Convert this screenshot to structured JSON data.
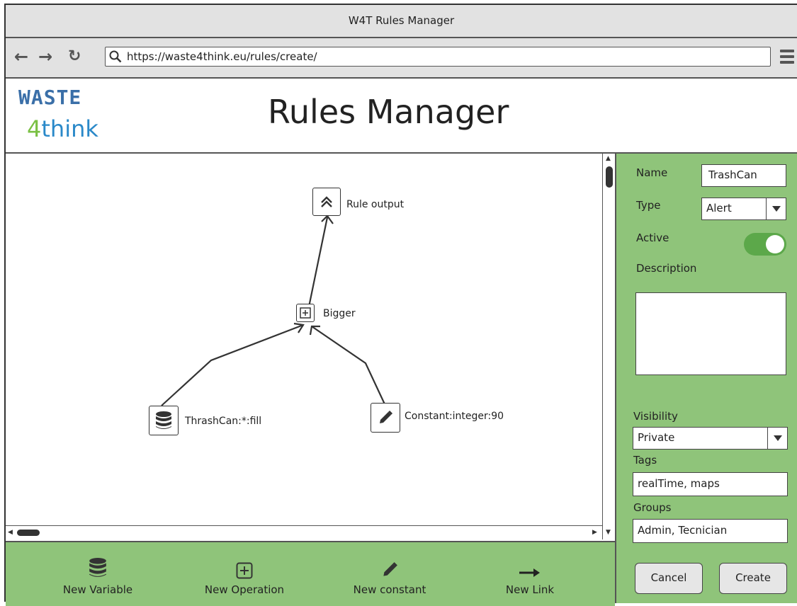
{
  "window": {
    "title": "W4T Rules Manager"
  },
  "browser": {
    "url": "https://waste4think.eu/rules/create/"
  },
  "logo": {
    "line1": "WASTE",
    "line2_prefix": "4",
    "line2_rest": "think"
  },
  "header": {
    "title": "Rules Manager"
  },
  "graph": {
    "nodes": [
      {
        "label": "Rule output"
      },
      {
        "label": "Bigger"
      },
      {
        "label": "ThrashCan:*:fill"
      },
      {
        "label": "Constant:integer:90"
      }
    ]
  },
  "toolbar": {
    "new_variable": "New Variable",
    "new_operation": "New Operation",
    "new_constant": "New constant",
    "new_link": "New Link"
  },
  "form": {
    "name_label": "Name",
    "name_value": "TrashCan",
    "type_label": "Type",
    "type_value": "Alert",
    "active_label": "Active",
    "active": true,
    "description_label": "Description",
    "description_value": "",
    "visibility_label": "Visibility",
    "visibility_value": "Private",
    "tags_label": "Tags",
    "tags_value": "realTime, maps",
    "groups_label": "Groups",
    "groups_value": "Admin, Tecnician",
    "cancel_label": "Cancel",
    "create_label": "Create"
  },
  "colors": {
    "panel_green": "#8fc47a",
    "toggle_green": "#5ca84a"
  }
}
